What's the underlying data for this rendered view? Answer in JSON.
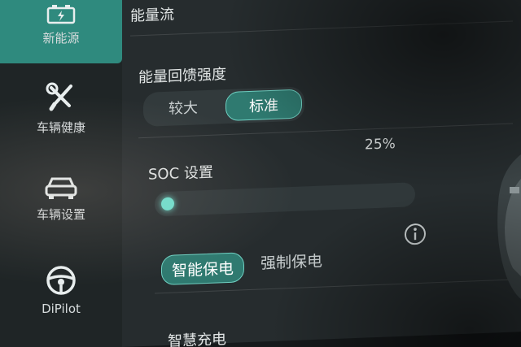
{
  "sidebar": {
    "items": [
      {
        "label": "新能源",
        "icon": "battery-icon",
        "active": true
      },
      {
        "label": "车辆健康",
        "icon": "tools-icon",
        "active": false
      },
      {
        "label": "车辆设置",
        "icon": "car-icon",
        "active": false
      },
      {
        "label": "DiPilot",
        "icon": "steering-wheel-icon",
        "active": false
      }
    ]
  },
  "main": {
    "energy_flow_title": "能量流",
    "regen": {
      "title": "能量回馈强度",
      "options": [
        "较大",
        "标准"
      ],
      "selected": "标准"
    },
    "soc": {
      "title": "SOC 设置",
      "value_label": "25%",
      "value": 25,
      "modes": [
        "智能保电",
        "强制保电"
      ],
      "selected_mode": "智能保电"
    },
    "smart_charge_title": "智慧充电"
  },
  "colors": {
    "accent": "#2f8a7e",
    "accent_glow": "#6fe1cf"
  }
}
